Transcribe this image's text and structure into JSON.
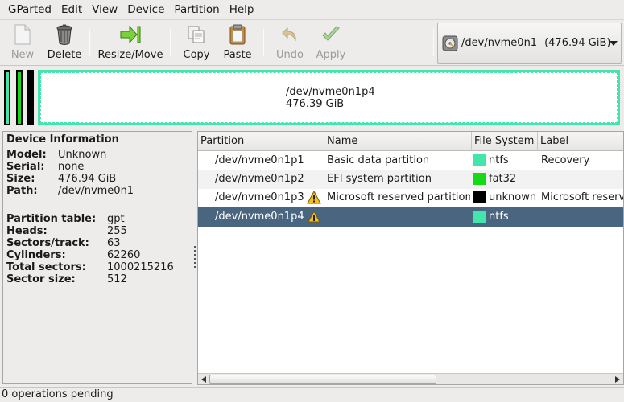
{
  "menu": {
    "items": [
      {
        "first": "G",
        "rest": "Parted"
      },
      {
        "first": "E",
        "rest": "dit"
      },
      {
        "first": "V",
        "rest": "iew"
      },
      {
        "first": "D",
        "rest": "evice"
      },
      {
        "first": "P",
        "rest": "artition"
      },
      {
        "first": "H",
        "rest": "elp"
      }
    ]
  },
  "toolbar": {
    "new_label": "New",
    "delete_label": "Delete",
    "resize_label": "Resize/Move",
    "copy_label": "Copy",
    "paste_label": "Paste",
    "undo_label": "Undo",
    "apply_label": "Apply"
  },
  "device_selector": {
    "device": "/dev/nvme0n1",
    "size": "(476.94 GiB)"
  },
  "visual": {
    "selected_name": "/dev/nvme0n1p4",
    "selected_size": "476.39 GiB"
  },
  "device_info": {
    "title": "Device Information",
    "model_k": "Model:",
    "model_v": "Unknown",
    "serial_k": "Serial:",
    "serial_v": "none",
    "size_k": "Size:",
    "size_v": "476.94 GiB",
    "path_k": "Path:",
    "path_v": "/dev/nvme0n1",
    "ptable_k": "Partition table:",
    "ptable_v": "gpt",
    "heads_k": "Heads:",
    "heads_v": "255",
    "sectors_k": "Sectors/track:",
    "sectors_v": "63",
    "cyl_k": "Cylinders:",
    "cyl_v": "62260",
    "total_k": "Total sectors:",
    "total_v": "1000215216",
    "ssize_k": "Sector size:",
    "ssize_v": "512"
  },
  "table": {
    "headers": {
      "partition": "Partition",
      "name": "Name",
      "fs": "File System",
      "label": "Label"
    },
    "rows": [
      {
        "partition": "/dev/nvme0n1p1",
        "name": "Basic data partition",
        "fs": "ntfs",
        "label": "Recovery"
      },
      {
        "partition": "/dev/nvme0n1p2",
        "name": "EFI system partition",
        "fs": "fat32",
        "label": ""
      },
      {
        "partition": "/dev/nvme0n1p3",
        "name": "Microsoft reserved partition",
        "fs": "unknown",
        "label": "Microsoft reserved partition"
      },
      {
        "partition": "/dev/nvme0n1p4",
        "name": "",
        "fs": "ntfs",
        "label": ""
      }
    ]
  },
  "colors": {
    "ntfs": "#42e5ac",
    "fat32": "#18d918",
    "unknown": "#000000",
    "selection": "#4a6580"
  },
  "status": {
    "text": "0 operations pending"
  }
}
